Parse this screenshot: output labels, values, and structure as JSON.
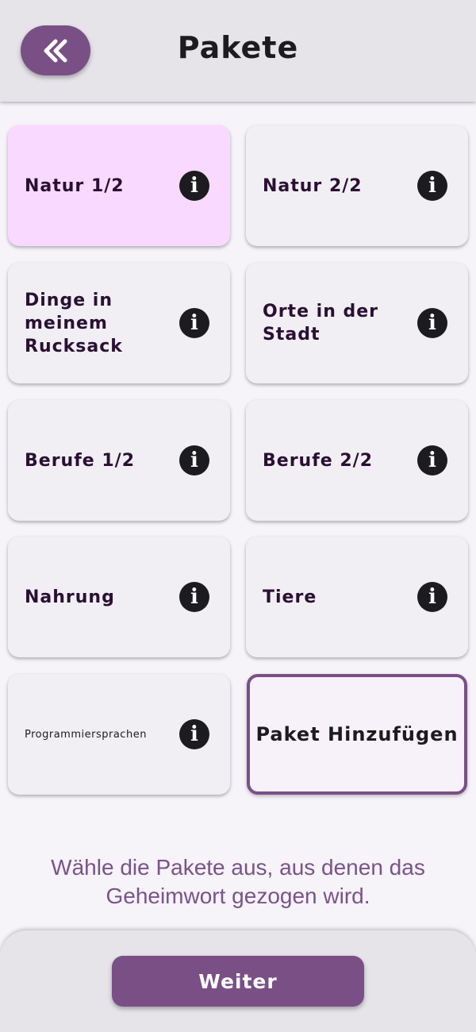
{
  "colors": {
    "accent": "#7a4f86",
    "selected_card": "#f9d9ff",
    "card": "#f1eff3",
    "hint_text": "#7a5388",
    "bar": "#e6e4e9"
  },
  "header": {
    "title": "Pakete",
    "back_icon": "double-chevron-left-icon"
  },
  "packages": [
    {
      "label": "Natur 1/2",
      "selected": true,
      "icon": "info-icon"
    },
    {
      "label": "Natur 2/2",
      "selected": false,
      "icon": "info-icon"
    },
    {
      "label": "Dinge in meinem Rucksack",
      "selected": false,
      "icon": "info-icon"
    },
    {
      "label": "Orte in der Stadt",
      "selected": false,
      "icon": "info-icon"
    },
    {
      "label": "Berufe 1/2",
      "selected": false,
      "icon": "info-icon"
    },
    {
      "label": "Berufe 2/2",
      "selected": false,
      "icon": "info-icon"
    },
    {
      "label": "Nahrung",
      "selected": false,
      "icon": "info-icon"
    },
    {
      "label": "Tiere",
      "selected": false,
      "icon": "info-icon"
    },
    {
      "label": "Programmiersprachen",
      "selected": false,
      "icon": "info-icon"
    }
  ],
  "info_glyph": "i",
  "add_package_label": "Paket Hinzufügen",
  "hint": "Wähle die Pakete aus, aus denen das Geheimwort gezogen wird.",
  "footer": {
    "next_label": "Weiter"
  }
}
